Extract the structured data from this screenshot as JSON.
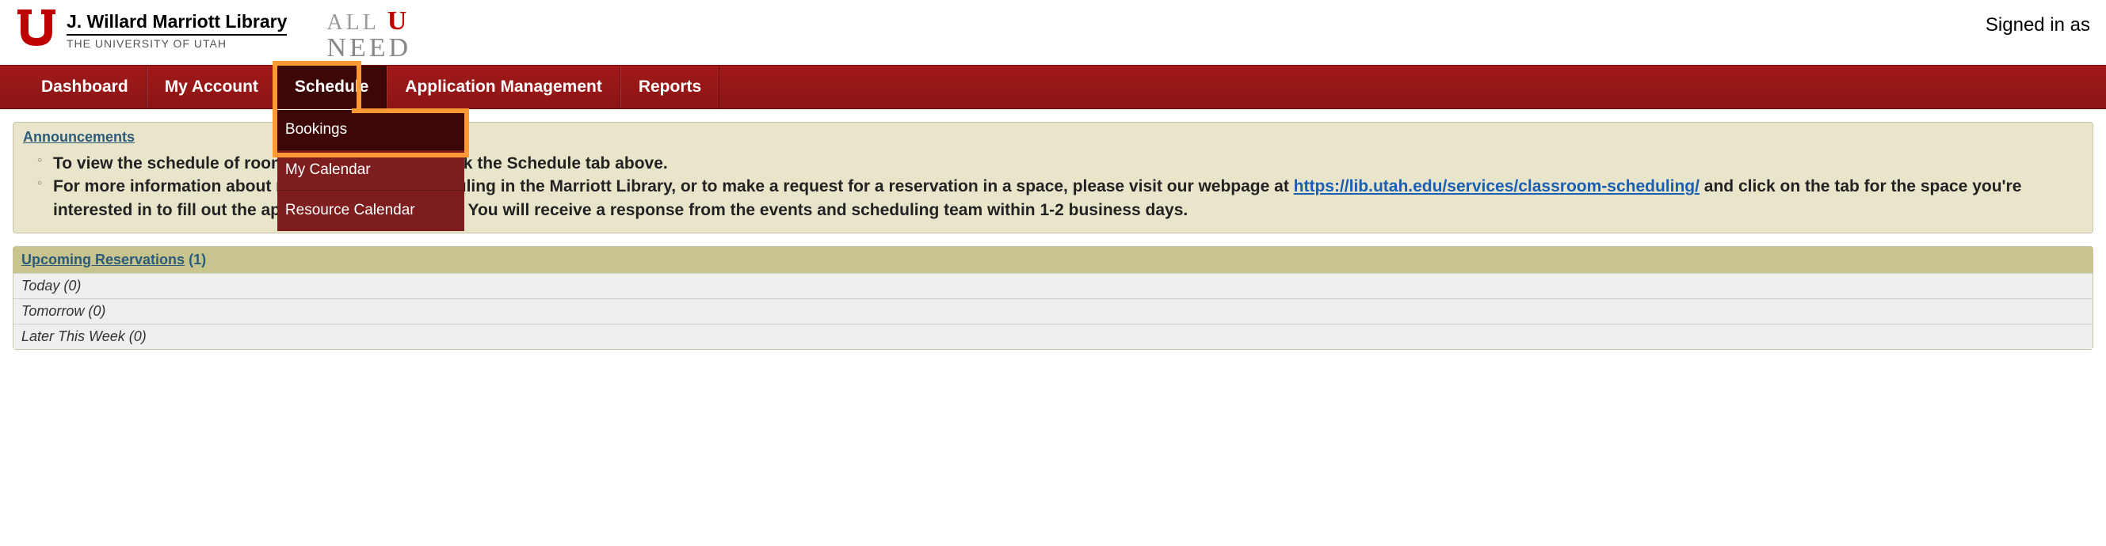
{
  "header": {
    "library_name": "J. Willard Marriott Library",
    "university_name": "THE UNIVERSITY OF UTAH",
    "tagline_all": "ALL",
    "tagline_u": "U",
    "tagline_need": "NEED",
    "signed_in": "Signed in as"
  },
  "nav": {
    "items": [
      {
        "label": "Dashboard"
      },
      {
        "label": "My Account"
      },
      {
        "label": "Schedule"
      },
      {
        "label": "Application Management"
      },
      {
        "label": "Reports"
      }
    ],
    "dropdown": [
      {
        "label": "Bookings"
      },
      {
        "label": "My Calendar"
      },
      {
        "label": "Resource Calendar"
      }
    ]
  },
  "announcements": {
    "title": "Announcements",
    "line1": "To view the schedule of rooms available, please click the Schedule tab above.",
    "line2_a": "For more information about room and space scheduling in the Marriott Library, or to make a request for a reservation in a space, please visit our webpage at ",
    "link": "https://lib.utah.edu/services/classroom-scheduling/",
    "line2_b": " and click on the tab for the space you're interested in to fill out the appropriate request form. You will receive a response from the events and scheduling team within 1-2 business days."
  },
  "reservations": {
    "title": "Upcoming Reservations",
    "count": "(1)",
    "rows": [
      "Today (0)",
      "Tomorrow (0)",
      "Later This Week (0)"
    ]
  }
}
